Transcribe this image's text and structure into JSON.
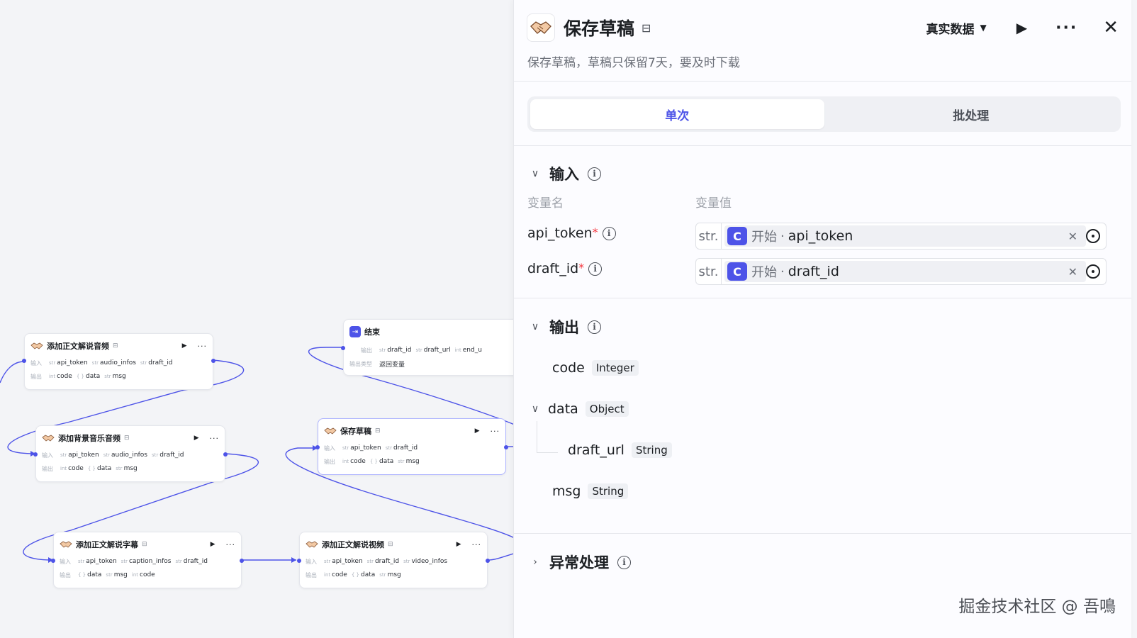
{
  "canvas": {
    "nodes": {
      "n1": {
        "title": "添加正文解说音频",
        "in_label": "输入",
        "out_label": "输出",
        "inputs": [
          {
            "t": "str",
            "n": "api_token"
          },
          {
            "t": "str",
            "n": "audio_infos"
          },
          {
            "t": "str",
            "n": "draft_id"
          }
        ],
        "outputs": [
          {
            "t": "int",
            "n": "code"
          },
          {
            "t": "{ }",
            "n": "data"
          },
          {
            "t": "str",
            "n": "msg"
          }
        ]
      },
      "n2": {
        "title": "添加背景音乐音频",
        "in_label": "输入",
        "out_label": "输出",
        "inputs": [
          {
            "t": "str",
            "n": "api_token"
          },
          {
            "t": "str",
            "n": "audio_infos"
          },
          {
            "t": "str",
            "n": "draft_id"
          }
        ],
        "outputs": [
          {
            "t": "int",
            "n": "code"
          },
          {
            "t": "{ }",
            "n": "data"
          },
          {
            "t": "str",
            "n": "msg"
          }
        ]
      },
      "n3": {
        "title": "添加正文解说字幕",
        "in_label": "输入",
        "out_label": "输出",
        "inputs": [
          {
            "t": "str",
            "n": "api_token"
          },
          {
            "t": "str",
            "n": "caption_infos"
          },
          {
            "t": "str",
            "n": "draft_id"
          }
        ],
        "outputs": [
          {
            "t": "{ }",
            "n": "data"
          },
          {
            "t": "str",
            "n": "msg"
          },
          {
            "t": "int",
            "n": "code"
          }
        ]
      },
      "n4": {
        "title": "结束",
        "out_label": "输出",
        "outtype_label": "输出类型",
        "outtype_value": "返回变量",
        "outputs": [
          {
            "t": "str",
            "n": "draft_id"
          },
          {
            "t": "str",
            "n": "draft_url"
          },
          {
            "t": "int",
            "n": "end_u"
          }
        ]
      },
      "n5": {
        "title": "保存草稿",
        "in_label": "输入",
        "out_label": "输出",
        "inputs": [
          {
            "t": "str",
            "n": "api_token"
          },
          {
            "t": "str",
            "n": "draft_id"
          }
        ],
        "outputs": [
          {
            "t": "int",
            "n": "code"
          },
          {
            "t": "{ }",
            "n": "data"
          },
          {
            "t": "str",
            "n": "msg"
          }
        ]
      },
      "n6": {
        "title": "添加正文解说视频",
        "in_label": "输入",
        "out_label": "输出",
        "inputs": [
          {
            "t": "str",
            "n": "api_token"
          },
          {
            "t": "str",
            "n": "draft_id"
          },
          {
            "t": "str",
            "n": "video_infos"
          }
        ],
        "outputs": [
          {
            "t": "int",
            "n": "code"
          },
          {
            "t": "{ }",
            "n": "data"
          },
          {
            "t": "str",
            "n": "msg"
          }
        ]
      }
    }
  },
  "panel": {
    "title": "保存草稿",
    "description": "保存草稿，草稿只保留7天，要及时下载",
    "mode_dropdown": "真实数据",
    "tabs": [
      "单次",
      "批处理"
    ],
    "input_section": {
      "title": "输入",
      "col_name": "变量名",
      "col_value": "变量值",
      "rows": [
        {
          "name": "api_token",
          "type": "str.",
          "node": "开始",
          "var": "api_token"
        },
        {
          "name": "draft_id",
          "type": "str.",
          "node": "开始",
          "var": "draft_id"
        }
      ]
    },
    "output_section": {
      "title": "输出",
      "fields": {
        "code": {
          "name": "code",
          "type": "Integer"
        },
        "data": {
          "name": "data",
          "type": "Object"
        },
        "draft_url": {
          "name": "draft_url",
          "type": "String"
        },
        "msg": {
          "name": "msg",
          "type": "String"
        }
      }
    },
    "exception_section": {
      "title": "异常处理"
    }
  },
  "watermark": "掘金技术社区 @ 吾鳴"
}
